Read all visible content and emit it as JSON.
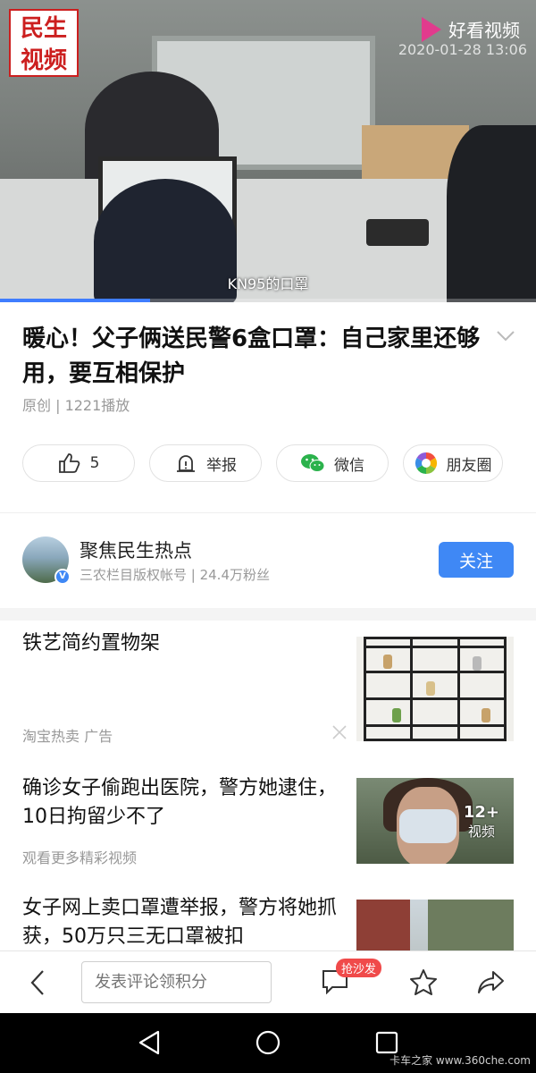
{
  "video": {
    "channel_logo": "民生视频",
    "brand": "好看视频",
    "stamp": "2020-01-28 13:06",
    "subtitle": "KN95的口罩",
    "progress_fraction": 0.28
  },
  "article": {
    "title": "暖心！父子俩送民警6盒口罩：自己家里还够用，要互相保护",
    "meta": "原创 | 1221播放"
  },
  "actions": [
    {
      "label": "5",
      "icon": "thumb-up-icon"
    },
    {
      "label": "举报",
      "icon": "report-icon"
    },
    {
      "label": "微信",
      "icon": "wechat-icon"
    },
    {
      "label": "朋友圈",
      "icon": "moments-icon"
    }
  ],
  "author": {
    "name": "聚焦民生热点",
    "sub": "三农栏目版权帐号 | 24.4万粉丝",
    "follow_label": "关注"
  },
  "feed": [
    {
      "title": "铁艺简约置物架",
      "sub": "淘宝热卖  广告"
    },
    {
      "title": "确诊女子偷跑出医院，警方她逮住，10日拘留少不了",
      "sub": "观看更多精彩视频",
      "badge_count": "12+",
      "badge_label": "视频"
    },
    {
      "title": "女子网上卖口罩遭举报，警方将她抓获，50万只三无口罩被扣"
    }
  ],
  "bottom_bar": {
    "comment_placeholder": "发表评论领积分",
    "sofa_badge": "抢沙发"
  },
  "watermark": "卡车之家 www.360che.com",
  "colors": {
    "accent": "#3f88f5",
    "badge_red": "#f04a4a",
    "channel_red": "#cc1f1f",
    "brand_pink": "#e13b8d"
  }
}
